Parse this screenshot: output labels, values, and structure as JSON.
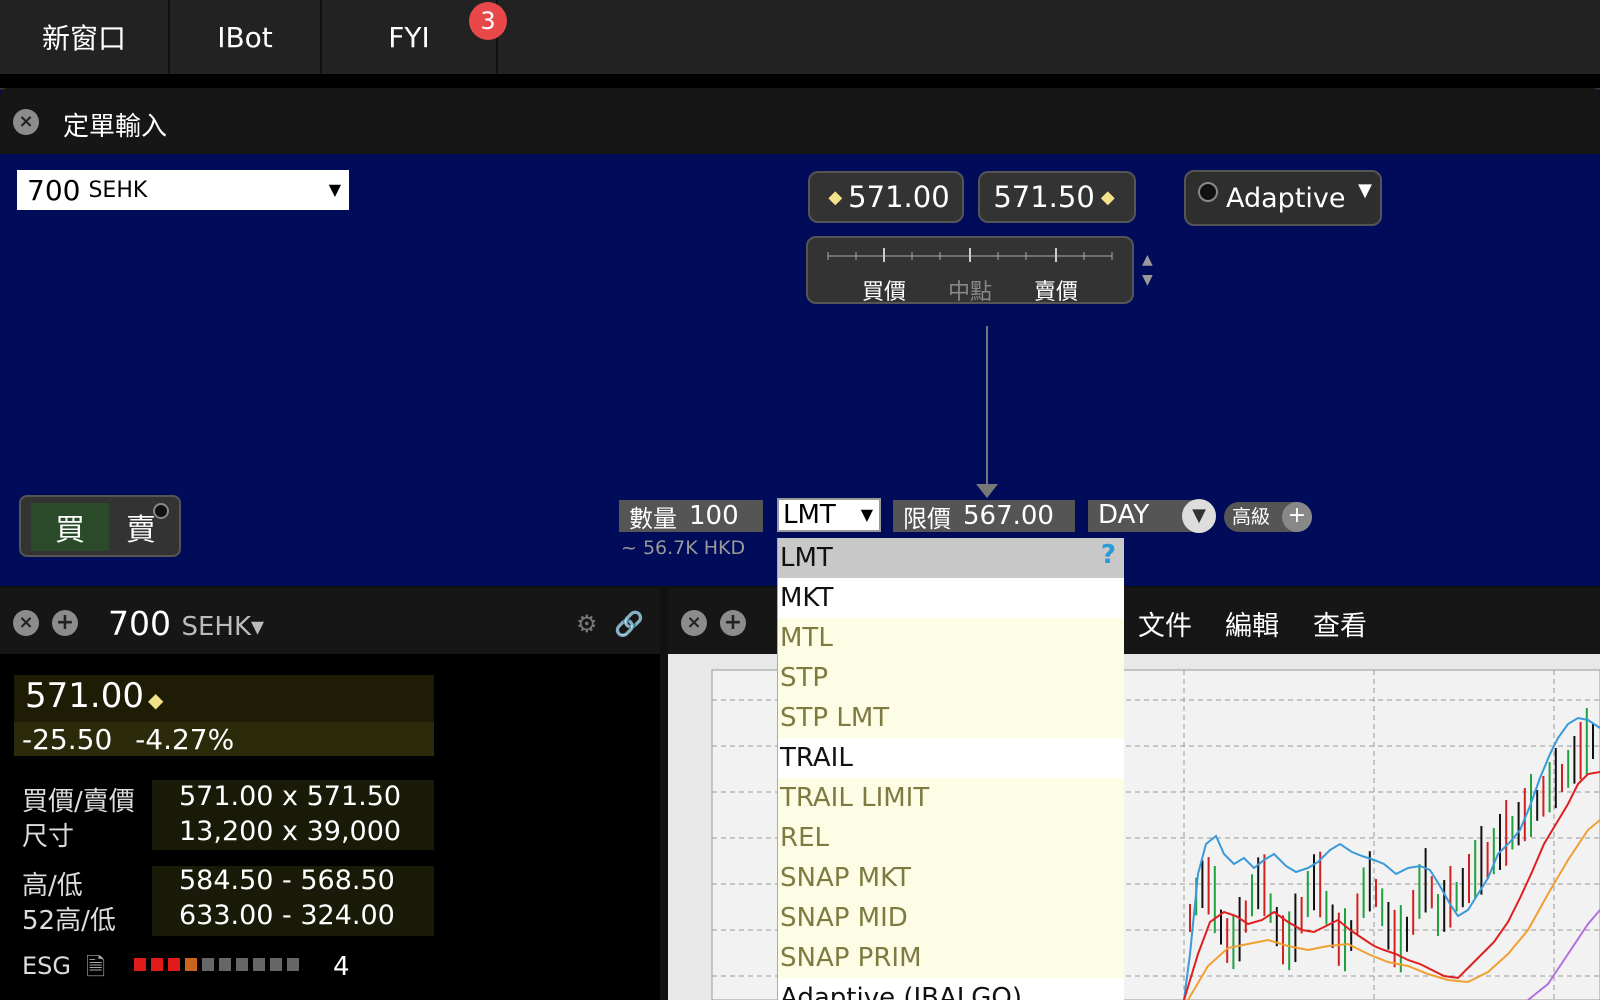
{
  "top_tabs": [
    {
      "label": "新窗口"
    },
    {
      "label": "IBot"
    },
    {
      "label": "FYI",
      "badge": "3"
    }
  ],
  "order_panel": {
    "title": "定單輸入",
    "symbol": "700",
    "exchange": "SEHK",
    "bid_price": "571.00",
    "ask_price": "571.50",
    "ruler_labels": [
      "買價",
      "中點",
      "賣價"
    ],
    "algo": "Adaptive",
    "buy_label": "買",
    "sell_label": "賣",
    "quantity_label": "數量",
    "quantity_value": "100",
    "quantity_note": "~ 56.7K HKD",
    "order_type": "LMT",
    "limit_label": "限價",
    "limit_value": "567.00",
    "tif": "DAY",
    "advanced_label": "高級"
  },
  "order_type_options": [
    {
      "label": "LMT",
      "state": "selected"
    },
    {
      "label": "MKT",
      "state": "normal"
    },
    {
      "label": "MTL",
      "state": "disabled"
    },
    {
      "label": "STP",
      "state": "disabled"
    },
    {
      "label": "STP LMT",
      "state": "disabled"
    },
    {
      "label": "TRAIL",
      "state": "normal"
    },
    {
      "label": "TRAIL LIMIT",
      "state": "disabled"
    },
    {
      "label": "REL",
      "state": "disabled"
    },
    {
      "label": "SNAP MKT",
      "state": "disabled"
    },
    {
      "label": "SNAP MID",
      "state": "disabled"
    },
    {
      "label": "SNAP PRIM",
      "state": "disabled"
    },
    {
      "label": "Adaptive (IBALGO)",
      "state": "normal"
    }
  ],
  "help_mark": "?",
  "quote_panel": {
    "symbol": "700",
    "exchange": "SEHK",
    "last_price": "571.00",
    "change": "-25.50",
    "change_pct": "-4.27%",
    "stats": [
      {
        "label": "買價/賣價",
        "value": "571.00 x 571.50"
      },
      {
        "label": "尺寸",
        "value": "13,200 x 39,000"
      },
      {
        "label": "高/低",
        "value": "584.50 - 568.50"
      },
      {
        "label": "52高/低",
        "value": "633.00 - 324.00"
      }
    ],
    "esg_label": "ESG",
    "esg_score": "4",
    "esg_bar_colors": [
      "#e11a1a",
      "#e11a1a",
      "#e11a1a",
      "#c8641e",
      "#666",
      "#666",
      "#666",
      "#666",
      "#666",
      "#666"
    ]
  },
  "chart_panel": {
    "menu": [
      "文件",
      "編輯",
      "查看"
    ]
  },
  "colors": {
    "panel_bg": "#000b59",
    "accent_green": "#23d33c",
    "badge_red": "#e8484a",
    "dropdown_disabled_bg": "#fdfde6",
    "dropdown_disabled_text": "#7d7a42"
  }
}
